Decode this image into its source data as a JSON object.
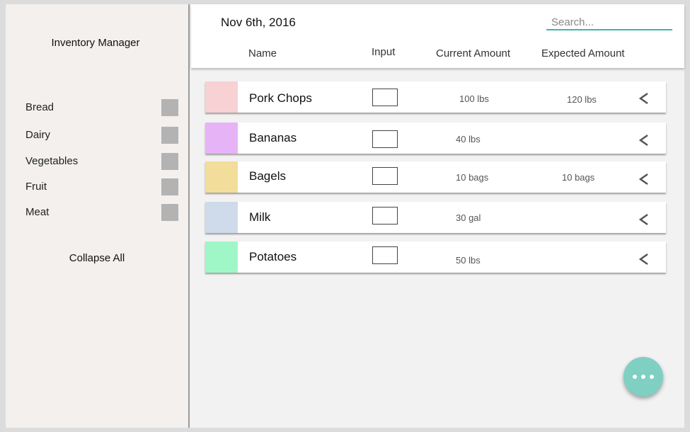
{
  "sidebar": {
    "title": "Inventory Manager",
    "categories": [
      {
        "label": "Bread"
      },
      {
        "label": "Dairy"
      },
      {
        "label": "Vegetables"
      },
      {
        "label": "Fruit"
      },
      {
        "label": "Meat"
      }
    ],
    "collapse_label": "Collapse All"
  },
  "header": {
    "date": "Nov 6th, 2016",
    "search_placeholder": "Search...",
    "columns": {
      "name": "Name",
      "input": "Input",
      "current": "Current Amount",
      "expected": "Expected Amount"
    }
  },
  "rows": [
    {
      "name": "Pork Chops",
      "color": "#f7d1d3",
      "current": "100 lbs",
      "expected": "120 lbs"
    },
    {
      "name": "Bananas",
      "color": "#e6b3f7",
      "current": "40 lbs",
      "expected": ""
    },
    {
      "name": "Bagels",
      "color": "#f2dd9a",
      "current": "10 bags",
      "expected": "10 bags"
    },
    {
      "name": "Milk",
      "color": "#cfdaea",
      "current": "30 gal",
      "expected": ""
    },
    {
      "name": "Potatoes",
      "color": "#9ff7c8",
      "current": "50 lbs",
      "expected": ""
    }
  ],
  "icons": {
    "row_action": "chevron-left-icon",
    "fab": "more-horizontal-icon"
  },
  "colors": {
    "accent": "#3cb8a8",
    "fab": "#7fcfc3"
  }
}
